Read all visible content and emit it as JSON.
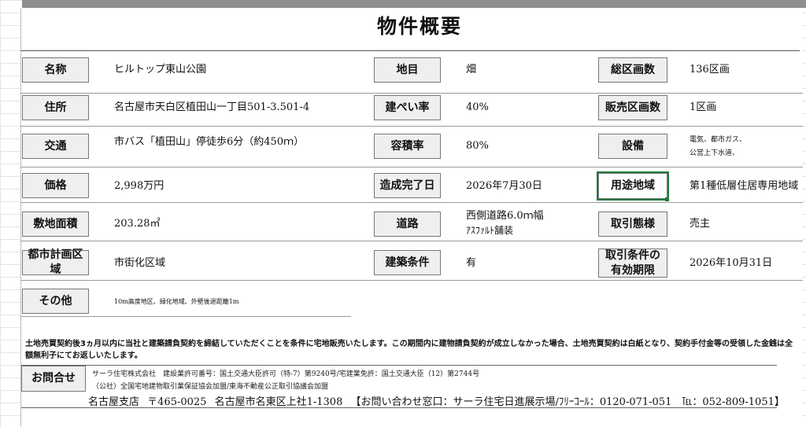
{
  "title": "物件概要",
  "fields": {
    "name": {
      "label": "名称",
      "value": "ヒルトップ東山公園"
    },
    "address": {
      "label": "住所",
      "value": "名古屋市天白区植田山一丁目501-3.501-4"
    },
    "transport": {
      "label": "交通",
      "value": "市バス「植田山」停徒歩6分（約450ｍ）"
    },
    "price": {
      "label": "価格",
      "value": "2,998万円"
    },
    "land_area": {
      "label": "敷地面積",
      "value": "203.28㎡"
    },
    "urban_zone": {
      "label": "都市計画区域",
      "value": "市街化区域"
    },
    "other": {
      "label": "その他",
      "value": "10m高度地区、緑化地域、外壁後退距離1m"
    },
    "land_category": {
      "label": "地目",
      "value": "畑"
    },
    "coverage": {
      "label": "建ぺい率",
      "value": "40%"
    },
    "floor_ratio": {
      "label": "容積率",
      "value": "80%"
    },
    "completion": {
      "label": "造成完了日",
      "value": "2026年7月30日"
    },
    "road": {
      "label": "道路",
      "value_1": "西側道路6.0ｍ幅",
      "value_2": "ｱｽﾌｧﾙﾄ舗装"
    },
    "build_cond": {
      "label": "建築条件",
      "value": "有"
    },
    "total_lots": {
      "label": "総区画数",
      "value": "136区画"
    },
    "sale_lots": {
      "label": "販売区画数",
      "value": "1区画"
    },
    "facilities": {
      "label": "設備",
      "value_1": "電気、都市ガス、",
      "value_2": "公営上下水道、"
    },
    "zoning": {
      "label": "用途地域",
      "value": "第1種低層住居専用地域"
    },
    "transaction": {
      "label": "取引態様",
      "value": "売主"
    },
    "validity": {
      "label": "取引条件の有効期限",
      "label_1": "取引条件の",
      "label_2": "有効期限",
      "value": "2026年10月31日"
    }
  },
  "notice": "土地売買契約後3ヵ月以内に当社と建築請負契約を締結していただくことを条件に宅地販売いたします。この期間内に建物請負契約が成立しなかった場合、土地売買契約は白紙となり、契約手付金等の受領した金銭は全額無利子にてお返しいたします。",
  "contact": {
    "label": "お問合せ",
    "line_1": "サーラ住宅株式会社　建設業許可番号：国土交通大臣許可（特-7）第9240号/宅建業免許：国土交通大臣（12）第2744号",
    "line_2": "（公社）全国宅地建物取引業保証協会加盟/東海不動産公正取引協議会加盟",
    "branch": "名古屋支店",
    "postal": "〒465-0025",
    "address": "名古屋市名東区上社1-1308",
    "inquiry": "【お問い合わせ窓口：サーラ住宅日進展示場/ﾌﾘｰｺｰﾙ：0120-071-051　℡：052-809-1051】"
  }
}
